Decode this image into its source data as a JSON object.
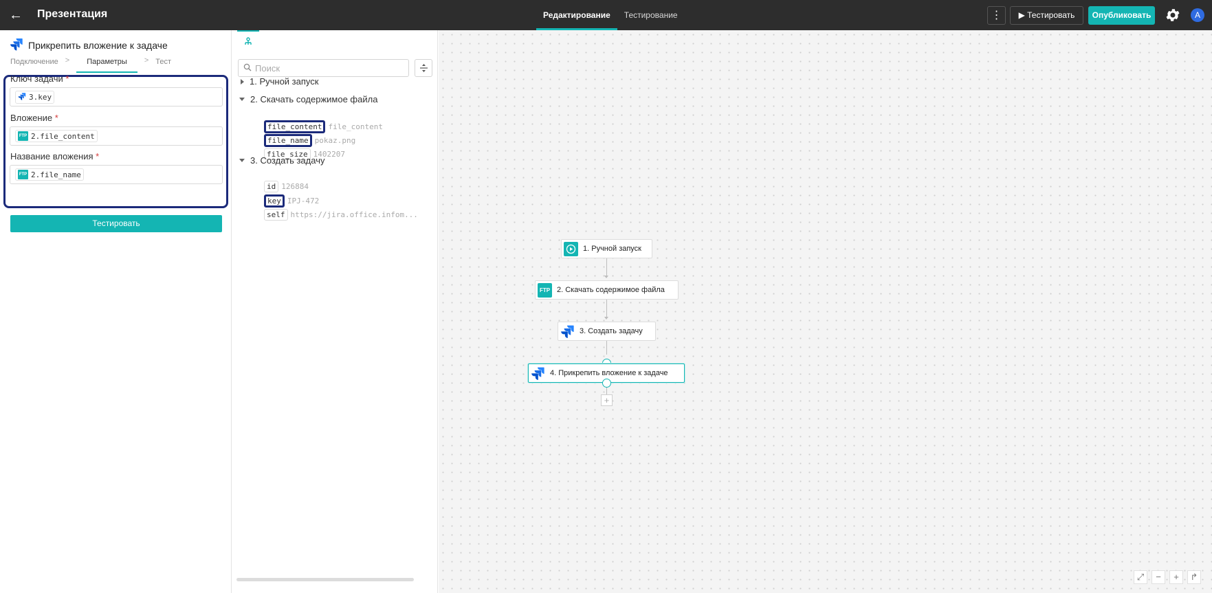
{
  "header": {
    "title": "Презентация",
    "modes": [
      "Редактирование",
      "Тестирование"
    ],
    "test_label": "Тестировать",
    "publish_label": "Опубликовать",
    "avatar_letter": "А"
  },
  "left": {
    "step_title": "Прикрепить вложение к задаче",
    "breadcrumbs": [
      "Подключение",
      "Параметры",
      "Тест"
    ],
    "fields": [
      {
        "label": "Ключ задачи",
        "value": "3.key"
      },
      {
        "label": "Вложение",
        "value": "2.file_content"
      },
      {
        "label": "Название вложения",
        "value": "2.file_name"
      }
    ],
    "required_mark": "*",
    "ftp_badge": "FTP",
    "test_button": "Тестировать"
  },
  "mid": {
    "search_placeholder": "Поиск",
    "tree": [
      {
        "label": "1. Ручной запуск",
        "expanded": false,
        "items": []
      },
      {
        "label": "2. Скачать содержимое файла",
        "expanded": true,
        "items": [
          {
            "key": "file_content",
            "value": "file_content",
            "highlighted": true
          },
          {
            "key": "file_name",
            "value": "pokaz.png",
            "highlighted": true
          },
          {
            "key": "file_size",
            "value": "1402207",
            "highlighted": false
          }
        ]
      },
      {
        "label": "3. Создать задачу",
        "expanded": true,
        "items": [
          {
            "key": "id",
            "value": "126884",
            "highlighted": false
          },
          {
            "key": "key",
            "value": "IPJ-472",
            "highlighted": true
          },
          {
            "key": "self",
            "value": "https://jira.office.infom...",
            "highlighted": false
          }
        ]
      }
    ]
  },
  "canvas": {
    "nodes": [
      {
        "label": "1. Ручной запуск",
        "icon": "play-icon"
      },
      {
        "label": "2. Скачать содержимое файла",
        "icon": "ftp-icon",
        "badge": "FTP"
      },
      {
        "label": "3. Создать задачу",
        "icon": "jira-icon"
      },
      {
        "label": "4. Прикрепить вложение к задаче",
        "icon": "jira-icon",
        "selected": true
      }
    ]
  },
  "colors": {
    "accent": "#14b5b3",
    "highlight": "#1b2a7a",
    "topbar": "#2d2d2d"
  }
}
